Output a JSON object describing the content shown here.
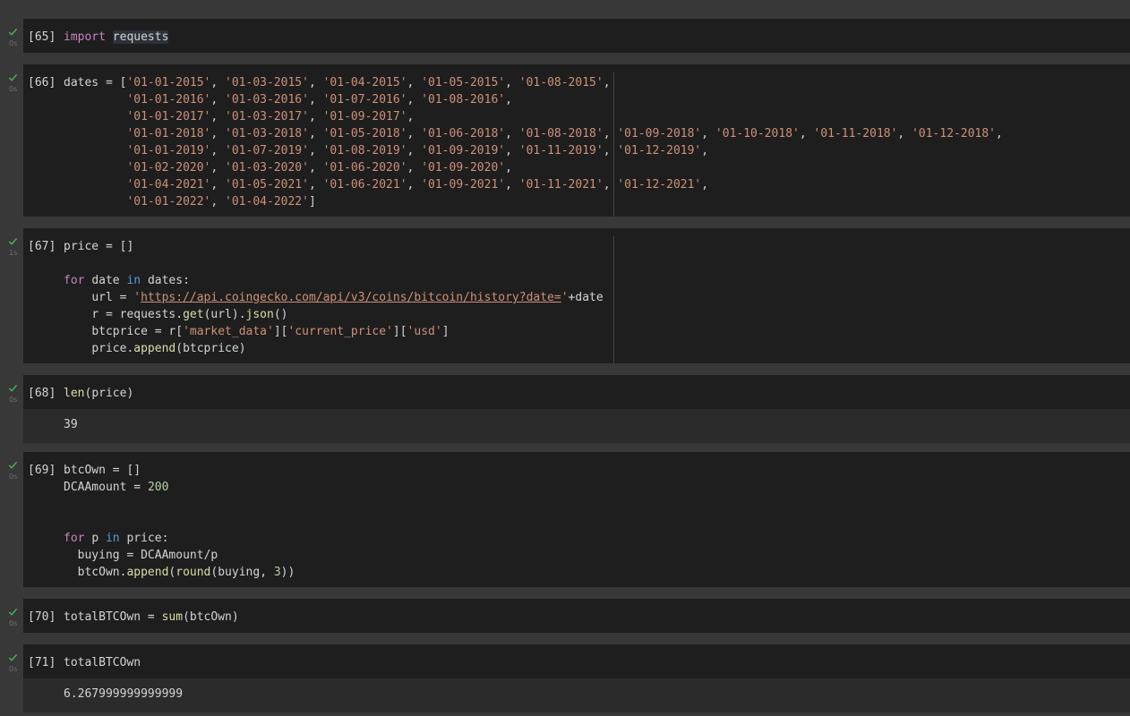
{
  "cells": [
    {
      "prompt": "[65]",
      "time": "0s",
      "code": [
        [
          "import",
          " ",
          "requests"
        ]
      ]
    },
    {
      "prompt": "[66]",
      "time": "0s",
      "lines": [
        "dates = ['01-01-2015', '01-03-2015', '01-04-2015', '01-05-2015', '01-08-2015',",
        "         '01-01-2016', '01-03-2016', '01-07-2016', '01-08-2016',",
        "         '01-01-2017', '01-03-2017', '01-09-2017',",
        "         '01-01-2018', '01-03-2018', '01-05-2018', '01-06-2018', '01-08-2018', '01-09-2018', '01-10-2018', '01-11-2018', '01-12-2018',",
        "         '01-01-2019', '01-07-2019', '01-08-2019', '01-09-2019', '01-11-2019', '01-12-2019',",
        "         '01-02-2020', '01-03-2020', '01-06-2020', '01-09-2020',",
        "         '01-04-2021', '01-05-2021', '01-06-2021', '01-09-2021', '01-11-2021', '01-12-2021',",
        "         '01-01-2022', '01-04-2022']"
      ]
    },
    {
      "prompt": "[67]",
      "time": "1s",
      "lines": [
        "price = []",
        "",
        "for date in dates:",
        "    url = 'https://api.coingecko.com/api/v3/coins/bitcoin/history?date='+date",
        "    r = requests.get(url).json()",
        "    btcprice = r['market_data']['current_price']['usd']",
        "    price.append(btcprice)"
      ]
    },
    {
      "prompt": "[68]",
      "time": "0s",
      "lines": [
        "len(price)"
      ],
      "output": "39"
    },
    {
      "prompt": "[69]",
      "time": "0s",
      "lines": [
        "btcOwn = []",
        "DCAAmount = 200",
        "",
        "",
        "for p in price:",
        "  buying = DCAAmount/p",
        "  btcOwn.append(round(buying, 3))"
      ]
    },
    {
      "prompt": "[70]",
      "time": "0s",
      "lines": [
        "totalBTCOwn = sum(btcOwn)"
      ]
    },
    {
      "prompt": "[71]",
      "time": "0s",
      "lines": [
        "totalBTCOwn"
      ],
      "output": "6.267999999999999"
    }
  ],
  "colors": {
    "background": "#383838",
    "cell": "#1e1e1e",
    "output": "#2b2b2b",
    "keyword": "#c586c0",
    "keyword_blue": "#569cd6",
    "function": "#dcdcaa",
    "string": "#ce9178",
    "number": "#b5cea8",
    "check": "#3fb950"
  }
}
